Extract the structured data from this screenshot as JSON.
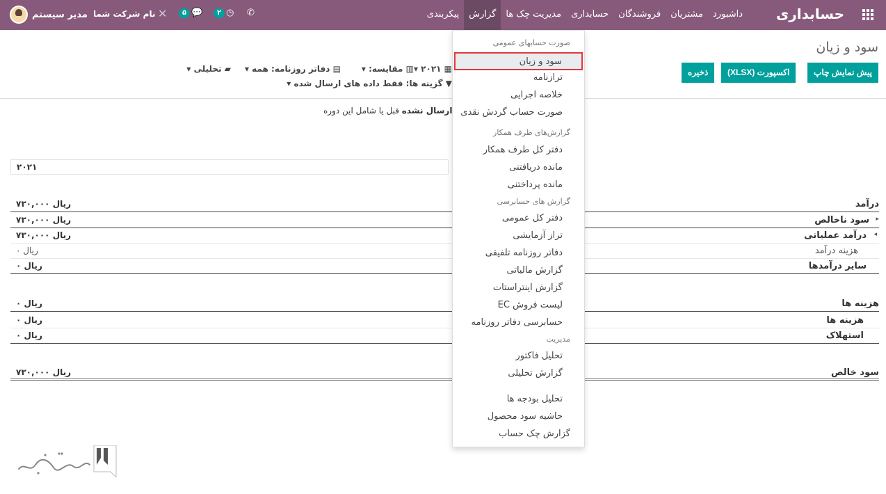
{
  "navbar": {
    "brand": "حسابداری",
    "menu": [
      "داشبورد",
      "مشتریان",
      "فروشندگان",
      "حسابداری",
      "مدیریت چک ها",
      "گزارش",
      "پیکربندی"
    ],
    "active_menu": "گزارش",
    "user_name": "مدیر سیستم",
    "company": "نام شرکت شما",
    "chat_count": "۵",
    "activity_count": "۲"
  },
  "control": {
    "breadcrumb": "سود و زیان",
    "buttons": {
      "print_preview": "پیش نمایش چاپ",
      "export_xlsx": "اکسپورت (XLSX)",
      "save": "ذخیره"
    },
    "filters": {
      "year": "۲۰۲۱",
      "compare": "مقایسه:",
      "journals": "دفاتر روزنامه: همه",
      "analytic": "تحلیلی",
      "options": "گزینه ها: فقط داده های ارسال شده"
    }
  },
  "report": {
    "warning_prefix": "ه ",
    "warning_bold": "ارسال نشده",
    "warning_suffix": " قبل یا شامل این دوره",
    "column_year": "۲۰۲۱",
    "rows": [
      {
        "label": "درآمد",
        "value": "۷۳۰,۰۰۰ ریال"
      },
      {
        "label": "سود ناخالص",
        "value": "۷۳۰,۰۰۰ ریال"
      },
      {
        "label": "درآمد عملیاتی",
        "value": "۷۳۰,۰۰۰ ریال"
      },
      {
        "label": "هزینه درآمد",
        "value": "۰ ریال"
      },
      {
        "label": "سایر درآمدها",
        "value": "۰ ریال"
      },
      {
        "label": "هزینه ها",
        "value": "۰ ریال"
      },
      {
        "label": "هزینه ها",
        "value": "۰ ریال"
      },
      {
        "label": "استهلاک",
        "value": "۰ ریال"
      },
      {
        "label": "سود خالص",
        "value": "۷۳۰,۰۰۰ ریال"
      }
    ]
  },
  "dropdown": {
    "headers": [
      "صورت حسابهای عمومی",
      "گزارش‌های طرف همکار",
      "گزارش های حسابرسی",
      "مدیریت"
    ],
    "items": [
      "سود و زیان",
      "ترازنامه",
      "خلاصه اجرایی",
      "صورت حساب گردش نقدی",
      "دفتر کل طرف همکار",
      "مانده دریافتنی",
      "مانده پرداختنی",
      "دفتر کل عمومی",
      "تراز آزمایشی",
      "دفاتر روزنامه تلفیقی",
      "گزارش مالیاتی",
      "گزارش اینتراستات",
      "لیست فروش EC",
      "حسابرسی دفاتر روزنامه",
      "تحلیل فاکتور",
      "گزارش تحلیلی",
      "تحلیل بودجه ها",
      "حاشیه سود محصول",
      "گزارش چک حساب"
    ]
  },
  "colors": {
    "navbar": "#875a7b",
    "button": "#00a09d",
    "highlight_border": "#e0393e"
  }
}
